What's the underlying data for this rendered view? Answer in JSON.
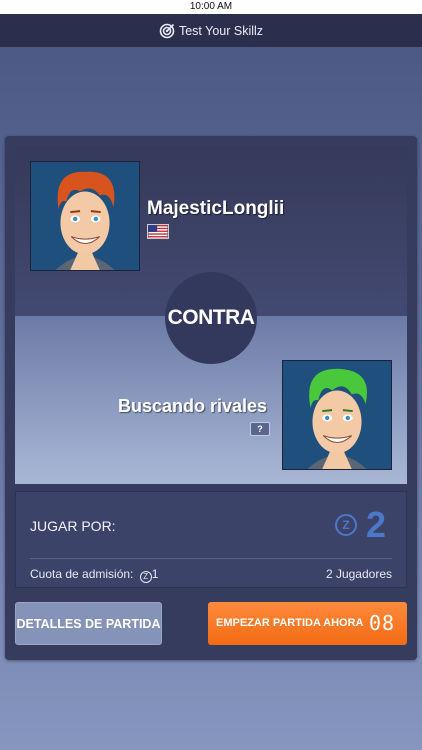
{
  "status_bar": {
    "time": "10:00 AM"
  },
  "header": {
    "title": "Test Your Skillz",
    "icon": "target-icon"
  },
  "match": {
    "player": {
      "name": "MajesticLonglii",
      "flag": "us-flag-icon"
    },
    "versus_label": "CONTRA",
    "opponent": {
      "name": "Buscando rivales",
      "badge": "?"
    }
  },
  "prize": {
    "label": "JUGAR POR:",
    "currency_icon": "Z",
    "amount": "2",
    "fee_label": "Cuota de admisión:",
    "fee_icon": "Z",
    "fee_value": "1",
    "players": "2 Jugadores"
  },
  "buttons": {
    "details": "DETALLES DE PARTIDA",
    "start": "EMPEZAR PARTIDA AHORA",
    "timer": "08"
  },
  "colors": {
    "accent_orange": "#f26b14",
    "accent_blue": "#4b78c9",
    "card": "#363c5e",
    "header": "#2b2f4d"
  }
}
